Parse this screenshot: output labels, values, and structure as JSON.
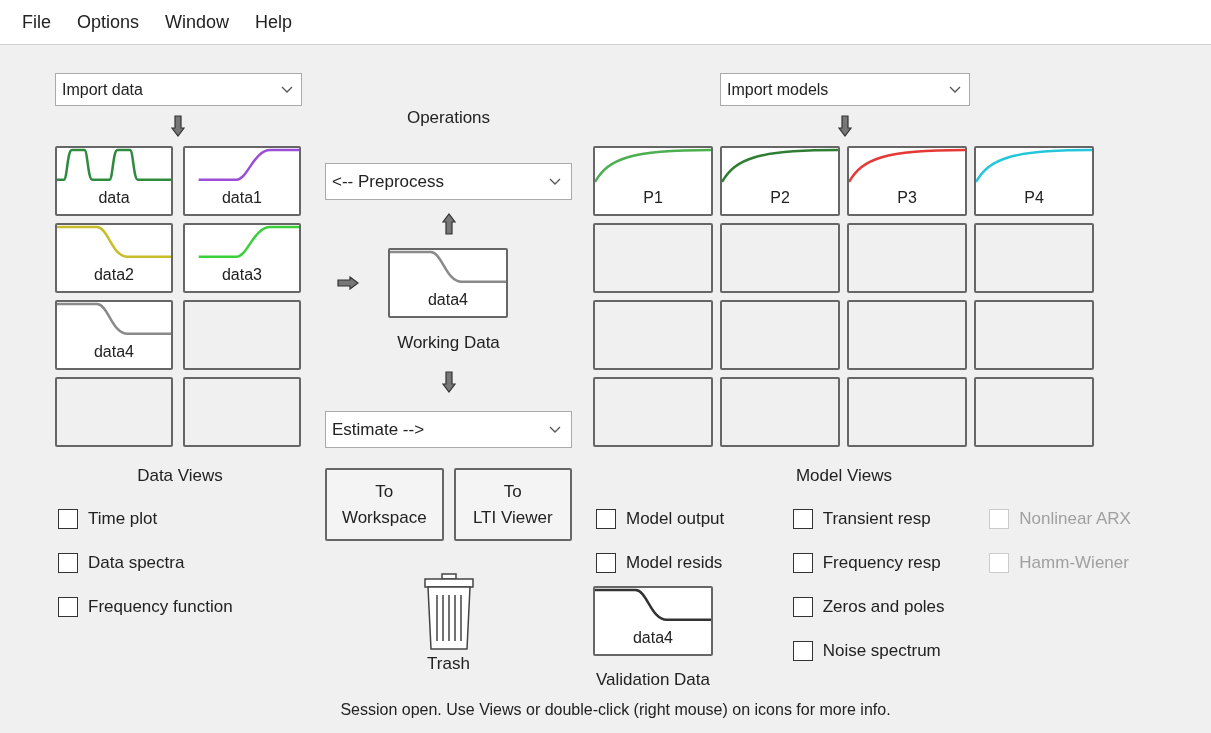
{
  "menu": [
    "File",
    "Options",
    "Window",
    "Help"
  ],
  "data_panel": {
    "dropdown": "Import data",
    "tiles": [
      {
        "kind": "pulse",
        "label": "data",
        "color": "#2e8b3e"
      },
      {
        "kind": "rise",
        "label": "data1",
        "color": "#9b4dd6"
      },
      {
        "kind": "fall",
        "label": "data2",
        "color": "#c8bd2a"
      },
      {
        "kind": "rise",
        "label": "data3",
        "color": "#3ccf3c"
      },
      {
        "kind": "fall",
        "label": "data4",
        "color": "#8a8a8a"
      },
      {
        "kind": "empty"
      },
      {
        "kind": "empty"
      },
      {
        "kind": "empty"
      }
    ],
    "title": "Data Views",
    "checkboxes": [
      {
        "label": "Time plot",
        "checked": false,
        "disabled": false
      },
      {
        "label": "Data spectra",
        "checked": false,
        "disabled": false
      },
      {
        "label": "Frequency function",
        "checked": false,
        "disabled": false
      }
    ]
  },
  "operations": {
    "title": "Operations",
    "preprocess": "<-- Preprocess",
    "working_data": {
      "kind": "fall",
      "label": "data4",
      "color": "#8a8a8a"
    },
    "working_title": "Working Data",
    "estimate": "Estimate -->",
    "buttons": [
      "To\nWorkspace",
      "To\nLTI Viewer"
    ],
    "trash": "Trash"
  },
  "model_panel": {
    "dropdown": "Import models",
    "tiles": [
      {
        "kind": "exp",
        "label": "P1",
        "color": "#4caf50"
      },
      {
        "kind": "exp",
        "label": "P2",
        "color": "#2e7d32"
      },
      {
        "kind": "exp",
        "label": "P3",
        "color": "#e53935"
      },
      {
        "kind": "exp",
        "label": "P4",
        "color": "#26c6da"
      },
      {
        "kind": "empty"
      },
      {
        "kind": "empty"
      },
      {
        "kind": "empty"
      },
      {
        "kind": "empty"
      },
      {
        "kind": "empty"
      },
      {
        "kind": "empty"
      },
      {
        "kind": "empty"
      },
      {
        "kind": "empty"
      },
      {
        "kind": "empty"
      },
      {
        "kind": "empty"
      },
      {
        "kind": "empty"
      },
      {
        "kind": "empty"
      }
    ],
    "title": "Model Views",
    "checkbox_columns": [
      [
        {
          "label": "Model output",
          "checked": false,
          "disabled": false
        },
        {
          "label": "Model resids",
          "checked": false,
          "disabled": false
        }
      ],
      [
        {
          "label": "Transient resp",
          "checked": false,
          "disabled": false
        },
        {
          "label": "Frequency resp",
          "checked": false,
          "disabled": false
        },
        {
          "label": "Zeros and poles",
          "checked": false,
          "disabled": false
        },
        {
          "label": "Noise spectrum",
          "checked": false,
          "disabled": false
        }
      ],
      [
        {
          "label": "Nonlinear ARX",
          "checked": false,
          "disabled": true
        },
        {
          "label": "Hamm-Wiener",
          "checked": false,
          "disabled": true
        }
      ]
    ],
    "validation_data": {
      "kind": "fall",
      "label": "data4",
      "color": "#333333"
    },
    "validation_title": "Validation Data"
  },
  "status_bar": "Session open. Use Views or double-click (right mouse) on icons for more info."
}
